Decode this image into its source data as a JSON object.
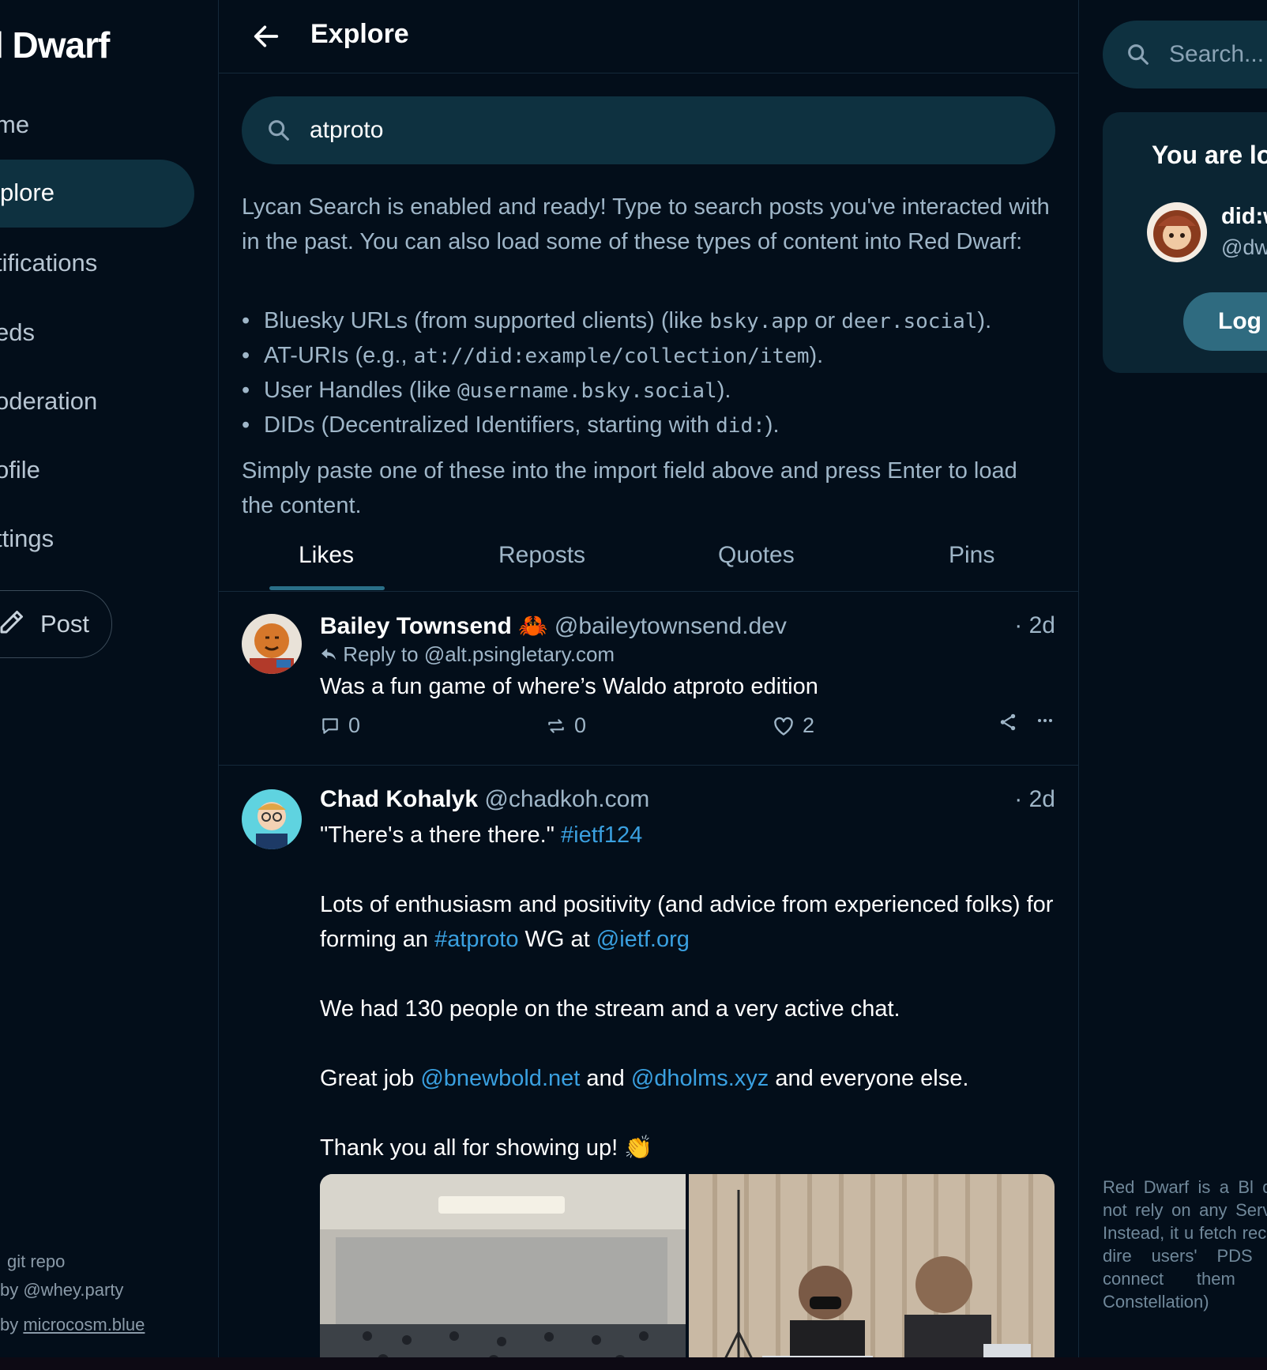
{
  "sidebar": {
    "brand": "l Dwarf",
    "nav": [
      {
        "label": "me"
      },
      {
        "label": "plore"
      },
      {
        "label": "tifications"
      },
      {
        "label": "eds"
      },
      {
        "label": "oderation"
      },
      {
        "label": "ofile"
      },
      {
        "label": "ttings"
      }
    ],
    "post_label": "Post",
    "footer": {
      "git": "git repo",
      "by_whey": "by @whey.party",
      "by_prefix": "by ",
      "microcosm": "microcosm.blue"
    }
  },
  "header": {
    "title": "Explore"
  },
  "search": {
    "value": "atproto"
  },
  "info": {
    "intro": "Lycan Search is enabled and ready! Type to search posts you've interacted with in the past. You can also load some of these types of content into Red Dwarf:",
    "bullets": [
      {
        "pre": "Bluesky URLs (from supported clients) (like ",
        "code1": "bsky.app",
        "mid": " or ",
        "code2": "deer.social",
        "post": ")."
      },
      {
        "pre": "AT-URIs (e.g., ",
        "code1": "at://did:example/collection/item",
        "post": ")."
      },
      {
        "pre": "User Handles (like ",
        "code1": "@username.bsky.social",
        "post": ")."
      },
      {
        "pre": "DIDs (Decentralized Identifiers, starting with ",
        "code1": "did:",
        "post": ")."
      }
    ],
    "outro": "Simply paste one of these into the import field above and press Enter to load the content."
  },
  "tabs": [
    "Likes",
    "Reposts",
    "Quotes",
    "Pins"
  ],
  "posts": [
    {
      "name": "Bailey Townsend",
      "emoji": "🦀",
      "handle": "@baileytownsend.dev",
      "time": "· 2d",
      "reply_to": "Reply to @alt.psingletary.com",
      "text": "Was a fun game of where’s Waldo atproto edition",
      "replies": "0",
      "reposts": "0",
      "likes": "2"
    },
    {
      "name": "Chad Kohalyk",
      "handle": "@chadkoh.com",
      "time": "· 2d",
      "line1": "\"There's a there there.\" ",
      "tag1": "#ietf124",
      "line2": "Lots of enthusiasm and positivity (and advice from experienced folks) for forming an ",
      "tag2": "#atproto",
      "line2b": " WG at ",
      "mention1": "@ietf.org",
      "line3": "We had 130 people on the stream and a very active chat.",
      "line4a": "Great job ",
      "mention2": "@bnewbold.net",
      "line4b": " and ",
      "mention3": "@dholms.xyz",
      "line4c": " and everyone else.",
      "line5": "Thank you all for showing up! 👏"
    }
  ],
  "right": {
    "search_placeholder": "Search...",
    "card_title": "You are lo",
    "card_did": "did:w",
    "card_handle": "@dw",
    "login": "Log",
    "about": "Red Dwarf is a Bl does not rely on any Servers. Instead, it u fetch records dire users' PDS (via connect them usin Constellation)"
  },
  "colors": {
    "background": "#030e1a",
    "accent": "#0e3140",
    "link": "#3aa0e0",
    "muted": "#9fb6c8"
  }
}
